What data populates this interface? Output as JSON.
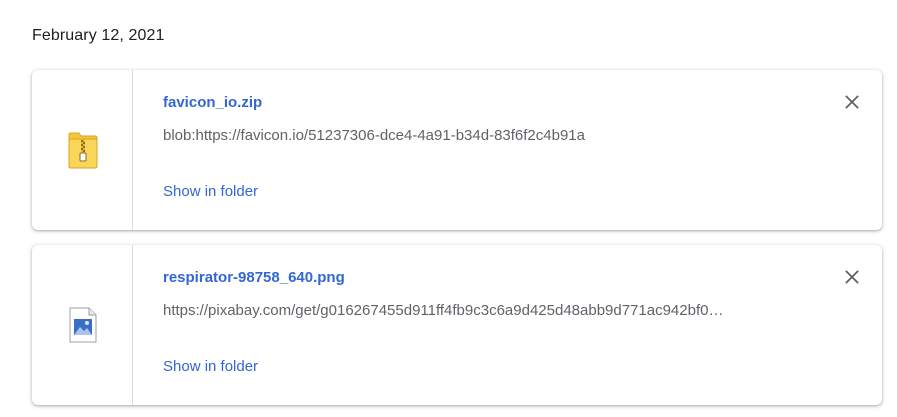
{
  "date_heading": "February 12, 2021",
  "downloads": [
    {
      "file_name": "favicon_io.zip",
      "url": "blob:https://favicon.io/51237306-dce4-4a91-b34d-83f6f2c4b91a",
      "show_in_folder_label": "Show in folder",
      "icon": "zip-archive-icon"
    },
    {
      "file_name": "respirator-98758_640.png",
      "url": "https://pixabay.com/get/g016267455d911ff4fb9c3c6a9d425d48abb9d771ac942bf0…",
      "show_in_folder_label": "Show in folder",
      "icon": "image-file-icon"
    }
  ],
  "colors": {
    "link": "#3367d6",
    "secondary_text": "#5f6368",
    "primary_text": "#202124"
  }
}
